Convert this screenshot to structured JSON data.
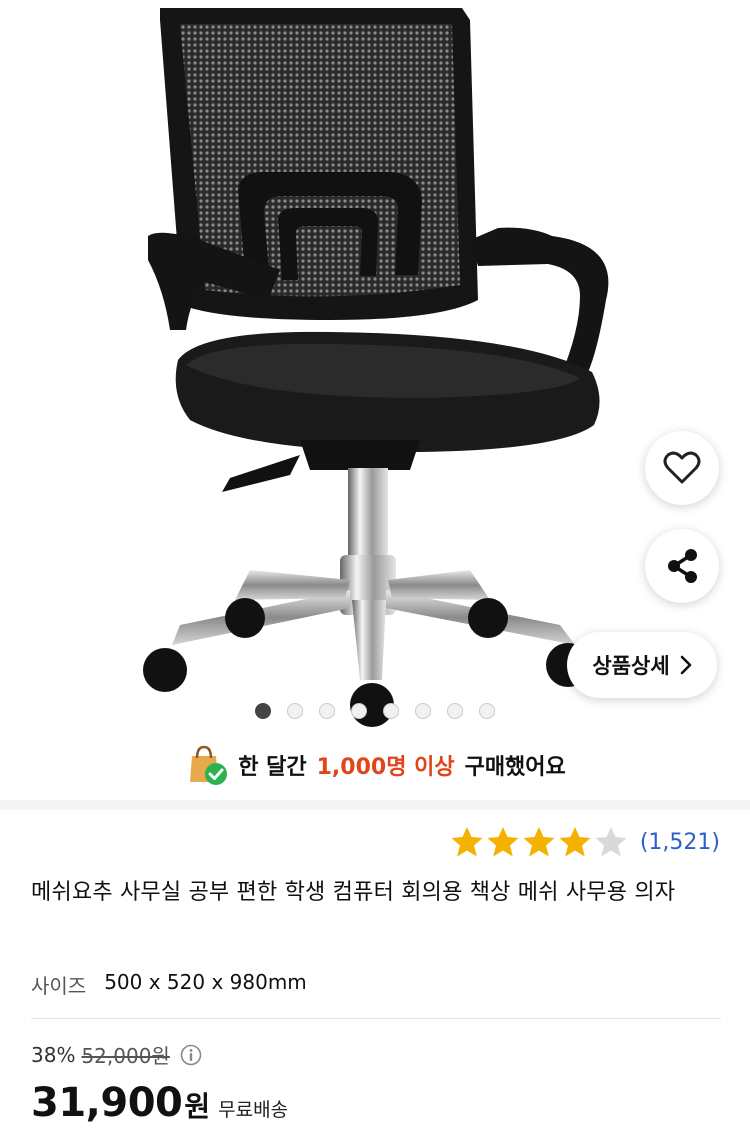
{
  "gallery": {
    "detail_button_label": "상품상세",
    "dots_total": 8,
    "dots_active_index": 0
  },
  "purchase": {
    "prefix": "한 달간",
    "highlight": "1,000명 이상",
    "suffix": "구매했어요"
  },
  "rating": {
    "stars": 4,
    "max_stars": 5,
    "count": "(1,521)"
  },
  "product": {
    "title": "메쉬요추 사무실 공부 편한 학생 컴퓨터 회의용 책상 메쉬 사무용 의자",
    "spec_label": "사이즈",
    "spec_value": "500 x 520 x 980mm"
  },
  "price": {
    "discount": "38%",
    "original": "52,000원",
    "sale": "31,900",
    "unit": "원",
    "shipping": "무료배송"
  },
  "colors": {
    "highlight": "#e0451b",
    "link": "#2e5ec7",
    "star": "#f5b100"
  },
  "icons": [
    "heart-icon",
    "share-icon",
    "chevron-right-icon",
    "shopping-bag-check-icon",
    "star-icon",
    "info-icon"
  ]
}
